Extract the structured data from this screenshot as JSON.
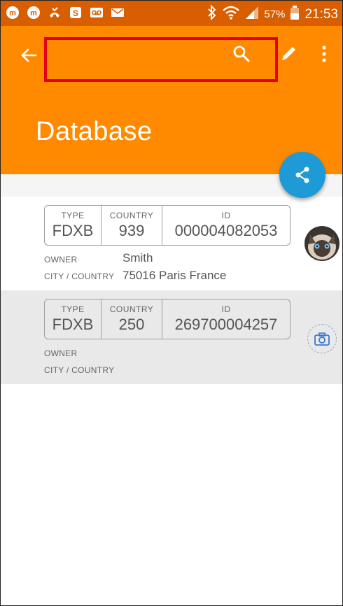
{
  "status_bar": {
    "battery_percent": "57%",
    "time": "21:53"
  },
  "app_bar": {
    "title": "Database"
  },
  "records": [
    {
      "type_label": "TYPE",
      "type": "FDXB",
      "country_label": "COUNTRY",
      "country": "939",
      "id_label": "ID",
      "id": "000004082053",
      "owner_label": "OWNER",
      "owner": "Smith",
      "city_label": "CITY / COUNTRY",
      "city": "75016 Paris France"
    },
    {
      "type_label": "TYPE",
      "type": "FDXB",
      "country_label": "COUNTRY",
      "country": "250",
      "id_label": "ID",
      "id": "269700004257",
      "owner_label": "OWNER",
      "owner": "",
      "city_label": "CITY / COUNTRY",
      "city": ""
    }
  ],
  "colors": {
    "status_bar": "#d85e00",
    "app_bar": "#ff8a00",
    "fab": "#1e9ad6",
    "highlight": "#e3001b"
  }
}
